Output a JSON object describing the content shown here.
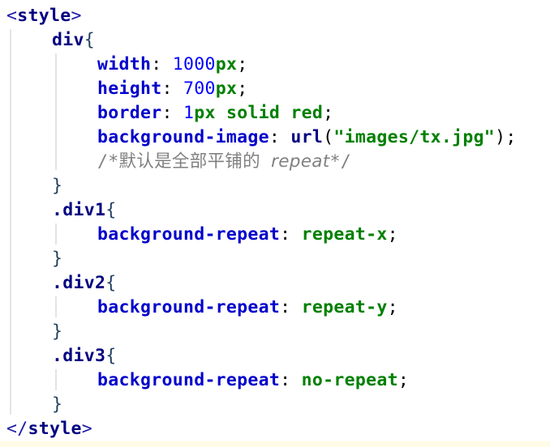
{
  "code": {
    "line1": {
      "open": "<",
      "tag": "style",
      "close": ">"
    },
    "line2": {
      "selector": "div",
      "brace": "{"
    },
    "line3": {
      "prop": "width",
      "colon": ":",
      "num": "1000",
      "unit": "px",
      "semi": ";"
    },
    "line4": {
      "prop": "height",
      "colon": ":",
      "num": "700",
      "unit": "px",
      "semi": ";"
    },
    "line5": {
      "prop": "border",
      "colon": ":",
      "num": "1",
      "value": "px solid red",
      "semi": ";"
    },
    "line6": {
      "prop": "background-image",
      "colon": ":",
      "fn": "url",
      "open_paren": "(",
      "str": "\"images/tx.jpg\"",
      "close_paren": ")",
      "semi": ";"
    },
    "line7": {
      "comment_start": "/*默认是全部平铺的 ",
      "comment_italic": "repeat",
      "comment_end": "*/"
    },
    "line8": {
      "brace": "}"
    },
    "line9": {
      "selector": ".div1",
      "brace": "{"
    },
    "line10": {
      "prop": "background-repeat",
      "colon": ":",
      "value": "repeat-x",
      "semi": ";"
    },
    "line11": {
      "brace": "}"
    },
    "line12": {
      "selector": ".div2",
      "brace": "{"
    },
    "line13": {
      "prop": "background-repeat",
      "colon": ":",
      "value": "repeat-y",
      "semi": ";"
    },
    "line14": {
      "brace": "}"
    },
    "line15": {
      "selector": ".div3",
      "brace": "{"
    },
    "line16": {
      "prop": "background-repeat",
      "colon": ":",
      "value": "no-repeat",
      "semi": ";"
    },
    "line17": {
      "brace": "}"
    },
    "line18": {
      "open": "</",
      "tag": "style",
      "close": ">"
    }
  },
  "colors": {
    "property": "#0000cc",
    "selector": "#000080",
    "value": "#008000",
    "number": "#0000ff",
    "comment": "#808080",
    "tag_bracket": "#1a1aa6"
  }
}
